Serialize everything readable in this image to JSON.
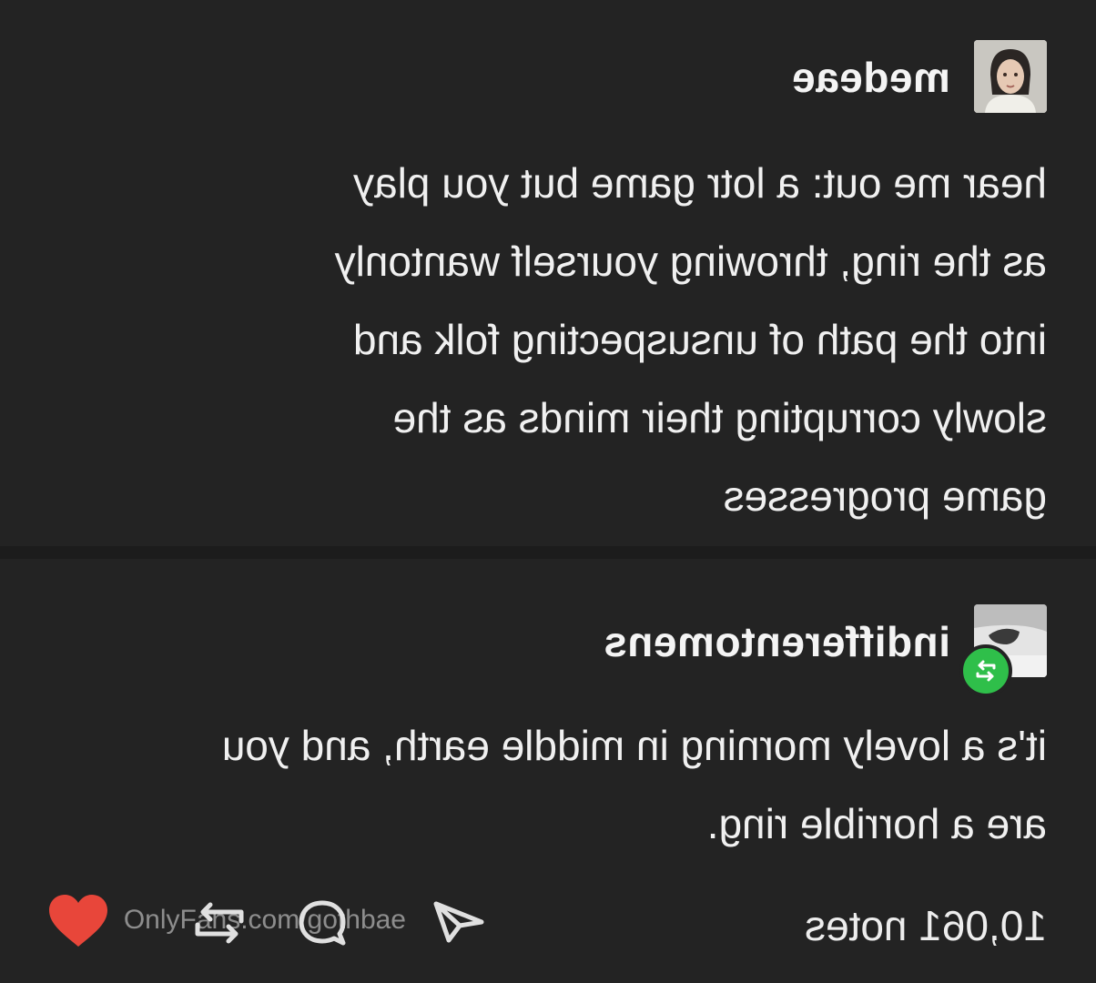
{
  "posts": [
    {
      "username": "medeae",
      "lines": [
        "hear me out: a lotr game but you play",
        "as the ring, throwing yourself wantonly",
        "into the path of unsuspecting folk and",
        "slowly corrupting their minds as the",
        "game progresses"
      ]
    },
    {
      "username": "indifferentomens",
      "lines": [
        "it's a lovely morning in middle earth, and you",
        "are a horrible ring."
      ]
    }
  ],
  "footer": {
    "notes": "10,061 notes",
    "watermark": "OnlyFans.com/gothbae"
  },
  "icons": {
    "share": "share-icon",
    "reply": "reply-icon",
    "reblog": "reblog-icon",
    "like": "heart-icon"
  },
  "colors": {
    "background": "#232323",
    "reblog_badge": "#2fbf4a",
    "like": "#e8463a"
  }
}
